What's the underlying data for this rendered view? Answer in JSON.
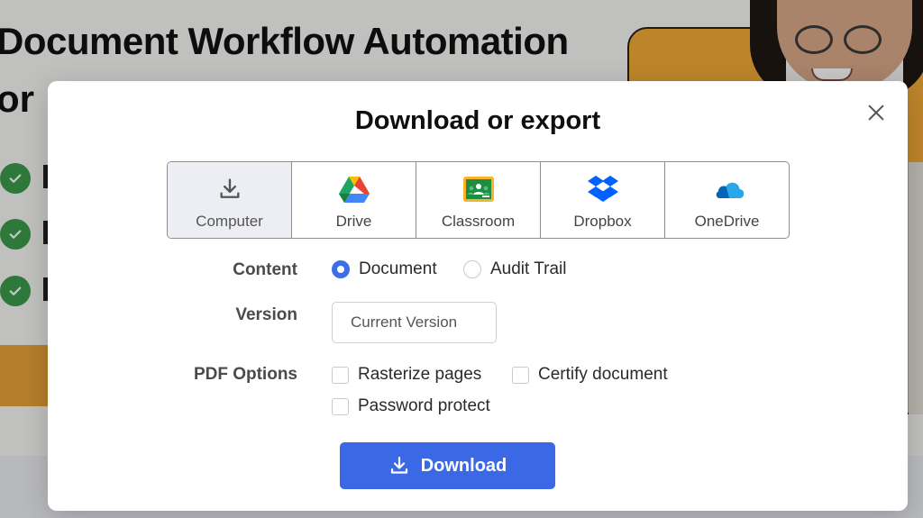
{
  "background": {
    "heading_line1": "Document Workflow Automation",
    "heading_line2": "or",
    "accent_orange": "#f2ab37",
    "check_green": "#3c9b4a"
  },
  "modal": {
    "title": "Download or export",
    "close_icon": "close-icon",
    "destinations": [
      {
        "label": "Computer",
        "icon": "download-icon",
        "selected": true
      },
      {
        "label": "Drive",
        "icon": "google-drive-icon",
        "selected": false
      },
      {
        "label": "Classroom",
        "icon": "google-classroom-icon",
        "selected": false
      },
      {
        "label": "Dropbox",
        "icon": "dropbox-icon",
        "selected": false
      },
      {
        "label": "OneDrive",
        "icon": "onedrive-icon",
        "selected": false
      }
    ],
    "content": {
      "label": "Content",
      "options": [
        {
          "label": "Document",
          "checked": true
        },
        {
          "label": "Audit Trail",
          "checked": false
        }
      ]
    },
    "version": {
      "label": "Version",
      "value": "Current Version"
    },
    "pdf_options": {
      "label": "PDF Options",
      "options": [
        {
          "label": "Rasterize pages",
          "checked": false
        },
        {
          "label": "Certify document",
          "checked": false
        },
        {
          "label": "Password protect",
          "checked": false
        }
      ]
    },
    "download_button": {
      "label": "Download",
      "color": "#3b69e6"
    }
  }
}
